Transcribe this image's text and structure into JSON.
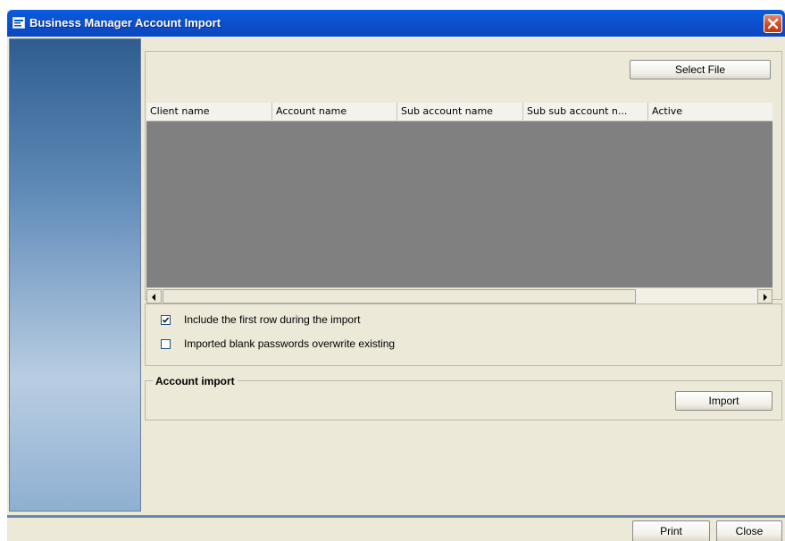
{
  "window": {
    "title": "Business Manager Account Import",
    "close_label": "close"
  },
  "toolbar": {
    "select_file_label": "Select File"
  },
  "grid": {
    "columns": [
      "Client name",
      "Account name",
      "Sub account name",
      "Sub sub account n...",
      "Active"
    ]
  },
  "options": [
    {
      "label": "Include the first row during the import",
      "checked": true
    },
    {
      "label": "Imported blank passwords overwrite existing",
      "checked": false
    }
  ],
  "import_section": {
    "title": "Account import",
    "import_label": "Import"
  },
  "footer": {
    "print_label": "Print",
    "close_label": "Close"
  },
  "colors": {
    "titlebar": "#0b4fcc",
    "grid_body": "#808080",
    "window_bg": "#ece9d8"
  }
}
